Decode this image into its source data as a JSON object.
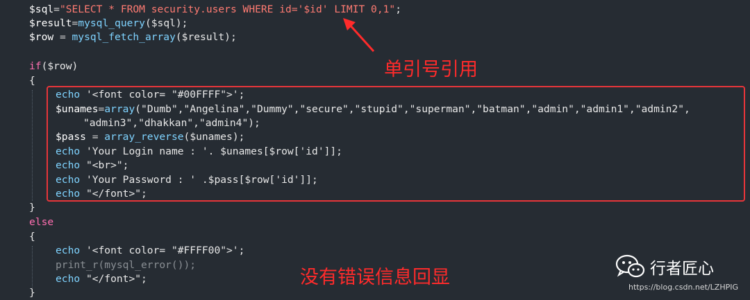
{
  "code": {
    "l1": {
      "a": "$sql",
      "b": "=",
      "c": "\"SELECT * FROM security.users WHERE id='$id' LIMIT 0,1\"",
      "d": ";"
    },
    "l2": {
      "a": "$result",
      "b": "=",
      "c": "mysql_query",
      "d": "($sql);"
    },
    "l3": {
      "a": "$row",
      "b": " = ",
      "c": "mysql_fetch_array",
      "d": "($result);"
    },
    "l5": {
      "a": "if",
      "b": "($row)"
    },
    "l6": "{",
    "l7": {
      "a": "echo",
      "b": " '<font color= \"#00FFFF\">';"
    },
    "l8": {
      "a": "$unames",
      "b": "=",
      "c": "array",
      "d": "(\"Dumb\",\"Angelina\",\"Dummy\",\"secure\",\"stupid\",\"superman\",\"batman\",\"admin\",\"admin1\",\"admin2\","
    },
    "l9": "\"admin3\",\"dhakkan\",\"admin4\");",
    "l10": {
      "a": "$pass",
      "b": " = ",
      "c": "array_reverse",
      "d": "($unames);"
    },
    "l11": {
      "a": "echo",
      "b": " 'Your Login name : '. $unames[$row['id']];"
    },
    "l12": {
      "a": "echo",
      "b": " \"<br>\";"
    },
    "l13": {
      "a": "echo",
      "b": " 'Your Password : ' .$pass[$row['id']];"
    },
    "l14": {
      "a": "echo",
      "b": " \"</font>\";"
    },
    "l15": "}",
    "l16": "else",
    "l17": "{",
    "l18": {
      "a": "echo",
      "b": " '<font color= \"#FFFF00\">';"
    },
    "l19": "print_r(mysql_error());",
    "l20": {
      "a": "echo",
      "b": " \"</font>\";"
    },
    "l21": "}"
  },
  "annotations": {
    "single_quote": "单引号引用",
    "no_error": "没有错误信息回显"
  },
  "watermark": {
    "icon": "wechat-icon",
    "name": "行者匠心",
    "url": "https://blog.csdn.net/LZHPIG"
  },
  "colors": {
    "background": "#262c33",
    "annotation": "#ff2b2b",
    "box": "#e8353a"
  }
}
